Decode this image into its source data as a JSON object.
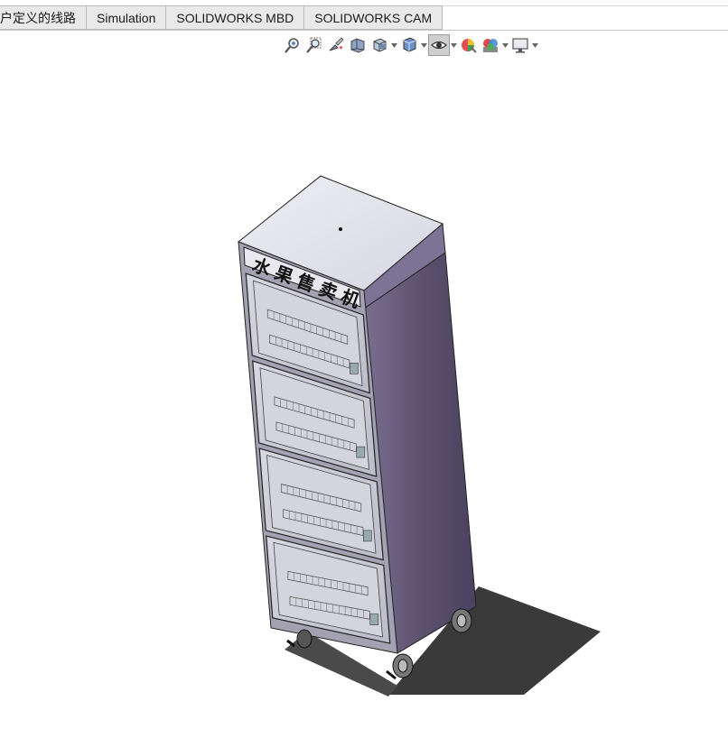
{
  "tabs": [
    {
      "label": "户定义的线路"
    },
    {
      "label": "Simulation"
    },
    {
      "label": "SOLIDWORKS MBD"
    },
    {
      "label": "SOLIDWORKS CAM"
    }
  ],
  "toolbar": {
    "icons": [
      "zoom-to-fit-icon",
      "zoom-to-area-icon",
      "previous-view-icon",
      "section-view-icon",
      "view-orientation-icon",
      "display-style-icon",
      "hide-show-items-icon",
      "edit-appearance-icon",
      "apply-scene-icon",
      "view-settings-icon"
    ]
  },
  "model": {
    "sign_text": [
      "水",
      "果",
      "售",
      "卖",
      "机"
    ]
  },
  "colors": {
    "body_side": "#5d5370",
    "body_front": "#9896a8",
    "top": "#e6e6ee",
    "shadow": "#3a3a3a",
    "tab_bg": "#e9e9e9"
  }
}
